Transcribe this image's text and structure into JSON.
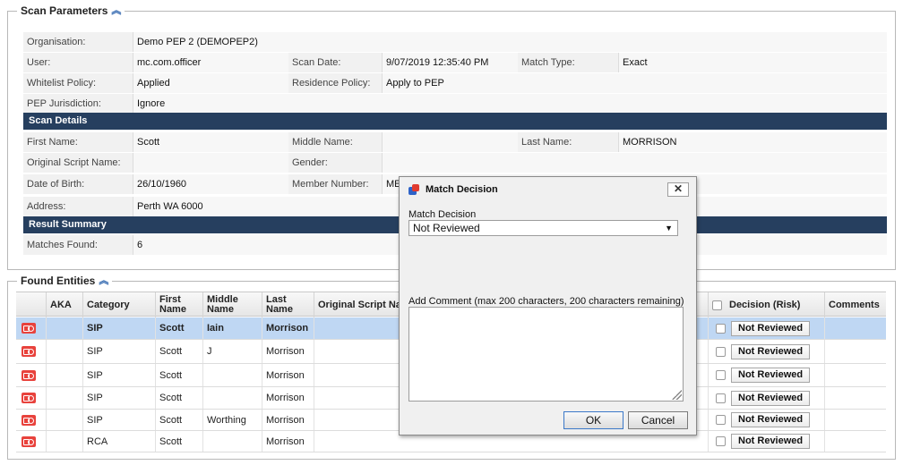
{
  "scan_parameters": {
    "legend": "Scan Parameters",
    "organisation_label": "Organisation:",
    "organisation_value": "Demo PEP 2 (DEMOPEP2)",
    "user_label": "User:",
    "user_value": "mc.com.officer",
    "scan_date_label": "Scan Date:",
    "scan_date_value": "9/07/2019 12:35:40 PM",
    "match_type_label": "Match Type:",
    "match_type_value": "Exact",
    "whitelist_label": "Whitelist Policy:",
    "whitelist_value": "Applied",
    "residence_label": "Residence Policy:",
    "residence_value": "Apply to PEP",
    "pep_label": "PEP Jurisdiction:",
    "pep_value": "Ignore",
    "scan_details_header": "Scan Details",
    "first_name_label": "First Name:",
    "first_name_value": "Scott",
    "middle_name_label": "Middle Name:",
    "middle_name_value": "",
    "last_name_label": "Last Name:",
    "last_name_value": "MORRISON",
    "original_script_label": "Original Script Name:",
    "original_script_value": "",
    "gender_label": "Gender:",
    "gender_value": "",
    "dob_label": "Date of Birth:",
    "dob_value": "26/10/1960",
    "member_number_label": "Member Number:",
    "member_number_value": "ME",
    "address_label": "Address:",
    "address_value": "Perth WA 6000",
    "result_summary_header": "Result Summary",
    "matches_label": "Matches Found:",
    "matches_value": "6"
  },
  "found_entities": {
    "legend": "Found Entities",
    "columns": {
      "aka": "AKA",
      "category": "Category",
      "first_name": "First Name",
      "middle_name": "Middle Name",
      "last_name": "Last Name",
      "original_script": "Original Script Name(s)",
      "decision": "Decision (Risk)",
      "comments": "Comments"
    },
    "rows": [
      {
        "category": "SIP",
        "first": "Scott",
        "middle": "Iain",
        "last": "Morrison",
        "decision": "Not Reviewed"
      },
      {
        "category": "SIP",
        "first": "Scott",
        "middle": "J",
        "last": "Morrison",
        "decision": "Not Reviewed"
      },
      {
        "category": "SIP",
        "first": "Scott",
        "middle": "",
        "last": "Morrison",
        "decision": "Not Reviewed"
      },
      {
        "category": "SIP",
        "first": "Scott",
        "middle": "",
        "last": "Morrison",
        "decision": "Not Reviewed"
      },
      {
        "category": "SIP",
        "first": "Scott",
        "middle": "Worthing",
        "last": "Morrison",
        "decision": "Not Reviewed"
      },
      {
        "category": "RCA",
        "first": "Scott",
        "middle": "",
        "last": "Morrison",
        "decision": "Not Reviewed"
      }
    ]
  },
  "modal": {
    "title": "Match Decision",
    "close_label": "✕",
    "decision_label": "Match Decision",
    "decision_value": "Not Reviewed",
    "comment_label": "Add Comment (max 200 characters, 200 characters remaining)",
    "comment_value": "",
    "ok_label": "OK",
    "cancel_label": "Cancel"
  }
}
